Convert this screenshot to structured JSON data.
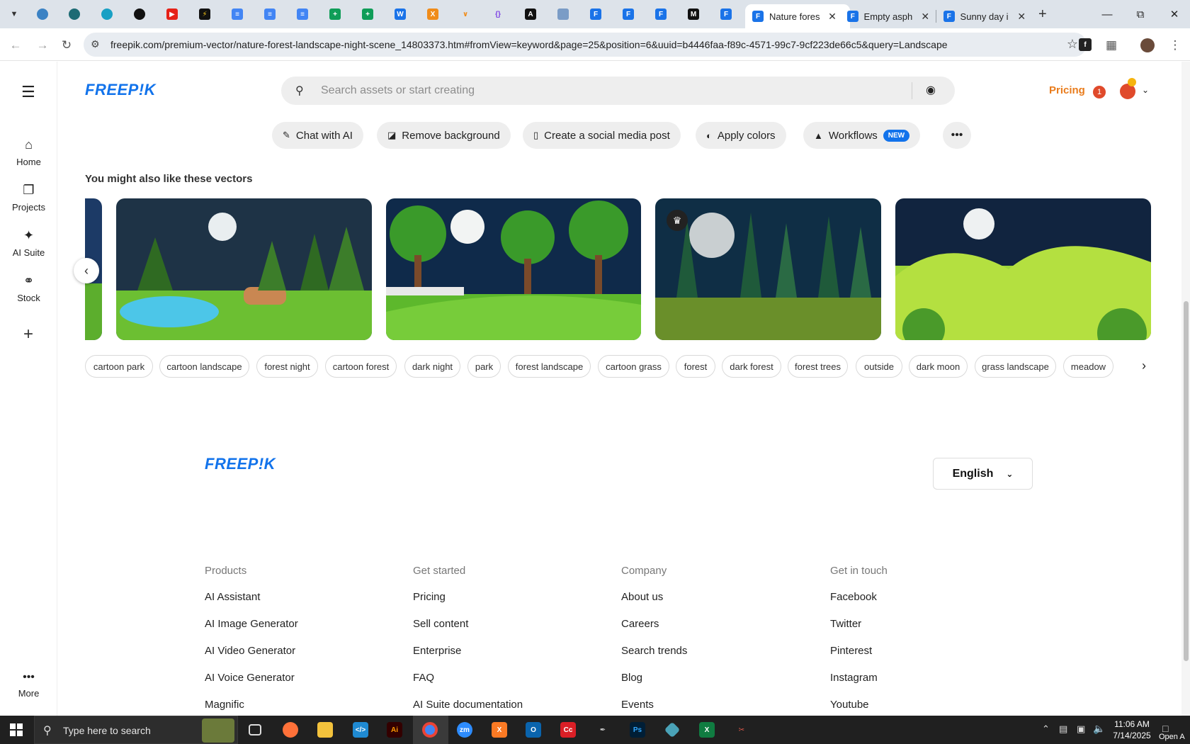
{
  "browser": {
    "tabs": [
      {
        "title": "Nature fores",
        "active": true
      },
      {
        "title": "Empty asph",
        "active": false
      },
      {
        "title": "Sunny day i",
        "active": false
      }
    ],
    "new_tab_label": "+",
    "url": "freepik.com/premium-vector/nature-forest-landscape-night-scene_14803373.htm#fromView=keyword&page=25&position=6&uuid=b4446faa-f89c-4571-99c7-9cf223de66c5&query=Landscape"
  },
  "rail": {
    "items": [
      {
        "label": "Home",
        "icon": "home-icon"
      },
      {
        "label": "Projects",
        "icon": "projects-icon"
      },
      {
        "label": "AI Suite",
        "icon": "sparkle-icon"
      },
      {
        "label": "Stock",
        "icon": "stock-icon"
      }
    ],
    "more_label": "More"
  },
  "header": {
    "logo": "FREEP!K",
    "search_placeholder": "Search assets or start creating",
    "pricing_label": "Pricing",
    "notification_count": "1"
  },
  "tools": {
    "chat": "Chat with AI",
    "remove_bg": "Remove background",
    "social": "Create a social media post",
    "colors": "Apply colors",
    "workflows": "Workflows",
    "new_badge": "NEW"
  },
  "section": {
    "heading": "You might also like these vectors"
  },
  "tags": [
    "cartoon park",
    "cartoon landscape",
    "forest night",
    "cartoon forest",
    "dark night",
    "park",
    "forest landscape",
    "cartoon grass",
    "forest",
    "dark forest",
    "forest trees",
    "outside",
    "dark moon",
    "grass landscape",
    "meadow"
  ],
  "footer": {
    "logo": "FREEP!K",
    "language": "English",
    "columns": [
      {
        "heading": "Products",
        "links": [
          "AI Assistant",
          "AI Image Generator",
          "AI Video Generator",
          "AI Voice Generator",
          "Magnific"
        ]
      },
      {
        "heading": "Get started",
        "links": [
          "Pricing",
          "Sell content",
          "Enterprise",
          "FAQ",
          "AI Suite documentation"
        ]
      },
      {
        "heading": "Company",
        "links": [
          "About us",
          "Careers",
          "Search trends",
          "Blog",
          "Events"
        ]
      },
      {
        "heading": "Get in touch",
        "links": [
          "Facebook",
          "Twitter",
          "Pinterest",
          "Instagram",
          "Youtube"
        ]
      }
    ]
  },
  "taskbar": {
    "search_placeholder": "Type here to search",
    "time": "11:06 AM",
    "date": "7/14/2025",
    "corner_text": "Open A"
  },
  "colors": {
    "brand": "#1273eb",
    "pricing": "#e97c1c",
    "taskbar": "#202020"
  }
}
